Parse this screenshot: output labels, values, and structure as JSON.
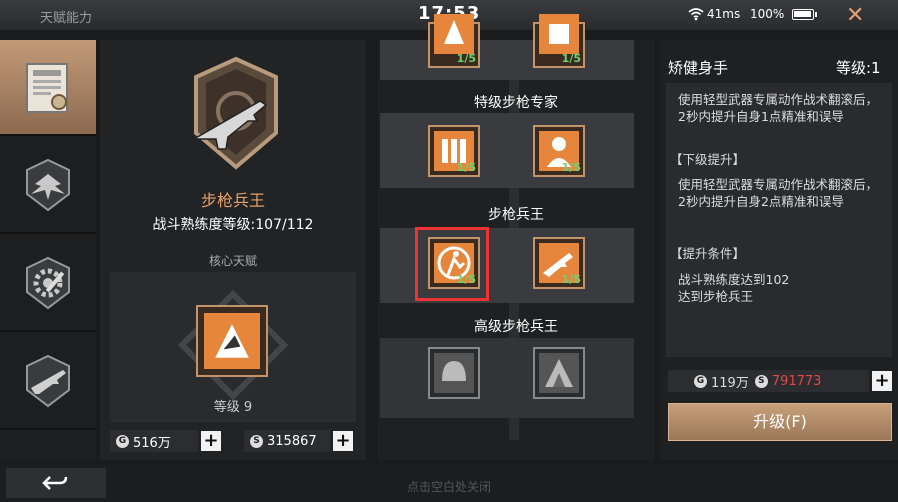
{
  "status_bar": {
    "title": "天赋能力",
    "time": "17:53",
    "ping": "41ms",
    "battery": "100%",
    "close_icon": "close-x-icon"
  },
  "sidebar": {
    "items": [
      {
        "icon": "certificate-icon",
        "active": true
      },
      {
        "icon": "wings-emblem-icon",
        "active": false
      },
      {
        "icon": "gear-wrench-icon",
        "active": false
      },
      {
        "icon": "rifle-emblem-icon",
        "active": false
      }
    ]
  },
  "left_panel": {
    "class_name": "步枪兵王",
    "mastery": "战斗熟练度等级:107/112",
    "core_label": "核心天赋",
    "core_level": "等级 9",
    "gold": "516万",
    "silver": "315867"
  },
  "tree": {
    "tiers": [
      {
        "heading": "",
        "nodes": [
          "1/5",
          "1/5"
        ]
      },
      {
        "heading": "特级步枪专家",
        "nodes": [
          "1/5",
          "1/5"
        ]
      },
      {
        "heading": "步枪兵王",
        "nodes": [
          "1/5",
          "1/5"
        ]
      },
      {
        "heading": "高级步枪兵王",
        "nodes": [
          "",
          ""
        ]
      }
    ]
  },
  "detail": {
    "name": "矫健身手",
    "level": "等级:1",
    "desc": "使用轻型武器专属动作战术翻滚后，2秒内提升自身1点精准和误导",
    "next_title": "【下级提升】",
    "next_desc": "使用轻型武器专属动作战术翻滚后，2秒内提升自身2点精准和误导",
    "req_title": "【提升条件】",
    "req_1": "战斗熟练度达到102",
    "req_2": "达到步枪兵王",
    "cost_gold": "119万",
    "cost_silver": "791773",
    "cost_silver_color": "#e04848",
    "upgrade_label": "升级(F)"
  },
  "bottom": {
    "hint": "点击空白处关闭"
  }
}
